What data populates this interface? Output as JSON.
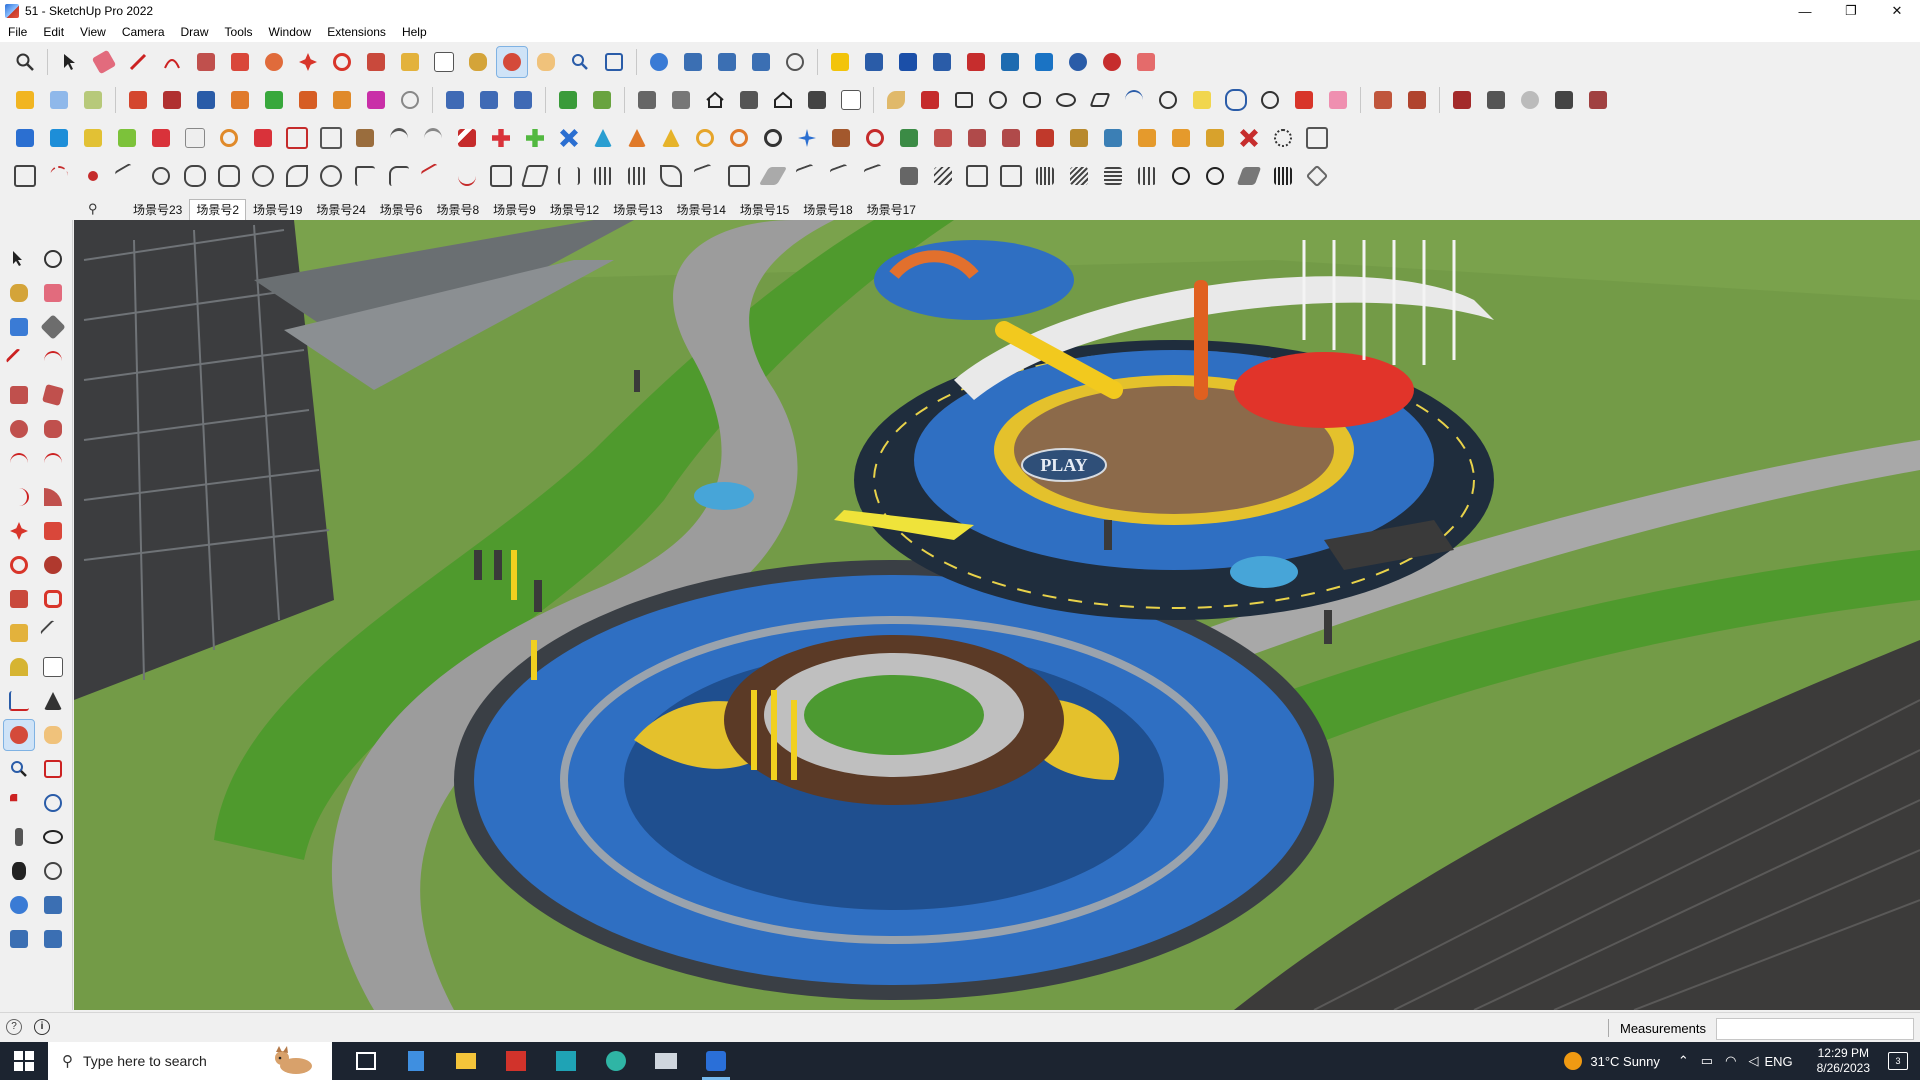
{
  "window": {
    "title": "51 - SketchUp Pro 2022",
    "controls": [
      "—",
      "❐",
      "✕"
    ]
  },
  "menu": {
    "items": [
      "File",
      "Edit",
      "View",
      "Camera",
      "Draw",
      "Tools",
      "Window",
      "Extensions",
      "Help"
    ]
  },
  "scenes": {
    "search_icon": "⚲",
    "tabs": [
      "场景号23",
      "场景号2",
      "场景号19",
      "场景号24",
      "场景号6",
      "场景号8",
      "场景号9",
      "场景号12",
      "场景号13",
      "场景号14",
      "场景号15",
      "场景号18",
      "场景号17"
    ],
    "active": "场景号2"
  },
  "viewport": {
    "play_sign": "PLAY"
  },
  "status": {
    "help_icon": "?",
    "info_icon": "i",
    "measurements_label": "Measurements",
    "measurements_value": ""
  },
  "taskbar": {
    "search_placeholder": "Type here to search",
    "weather": "31°C  Sunny",
    "language": "ENG",
    "time": "12:29 PM",
    "date": "8/26/2023",
    "notification_count": "3"
  },
  "colors": {
    "accent": "#cfe3f7",
    "taskbar": "#1c2430",
    "grass": "#6f9a43",
    "path_blue": "#2f6fc2",
    "path_dark": "#1f2d3d"
  }
}
